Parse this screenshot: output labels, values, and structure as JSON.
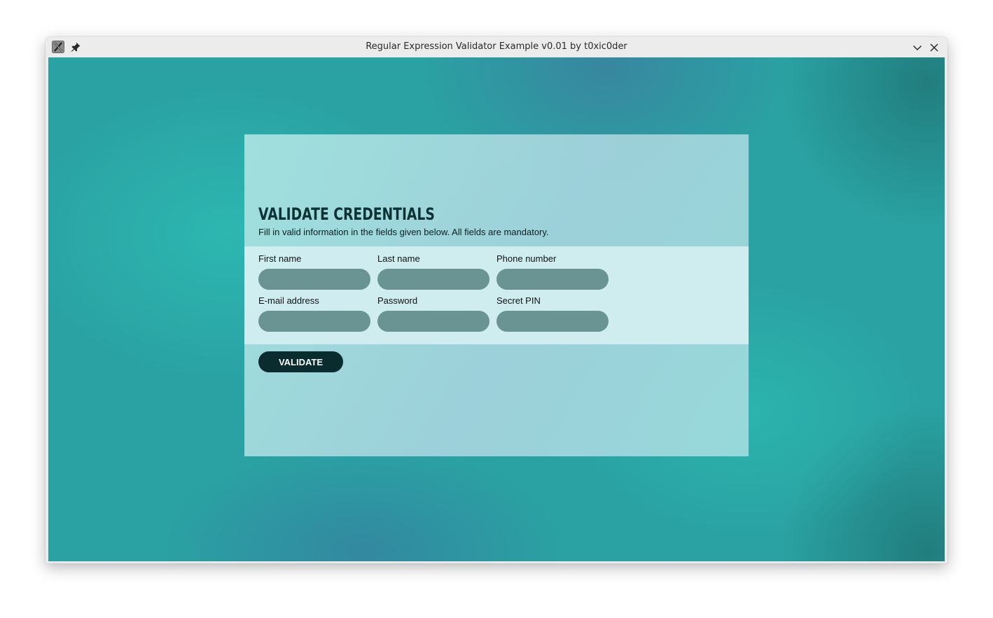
{
  "window": {
    "title": "Regular Expression Validator Example v0.01 by t0xic0der"
  },
  "titlebar": {
    "app_icon": "x-app-icon",
    "pin_icon": "pin-icon",
    "minimize_icon": "chevron-down-icon",
    "close_icon": "close-icon"
  },
  "form": {
    "title": "VALIDATE CREDENTIALS",
    "subtitle": "Fill in valid information in the fields given below. All fields are mandatory.",
    "fields": [
      {
        "label": "First name",
        "value": ""
      },
      {
        "label": "Last name",
        "value": ""
      },
      {
        "label": "Phone number",
        "value": ""
      },
      {
        "label": "E-mail address",
        "value": ""
      },
      {
        "label": "Password",
        "value": ""
      },
      {
        "label": "Secret PIN",
        "value": ""
      }
    ],
    "validate_label": "VALIDATE"
  },
  "colors": {
    "background_teal": "#2aa2a3",
    "panel": "#a8dcdc",
    "fields_band": "#d2eef0",
    "input_fill": "#6a9393",
    "button": "#0b2c2e",
    "title_text": "#0b3134"
  }
}
